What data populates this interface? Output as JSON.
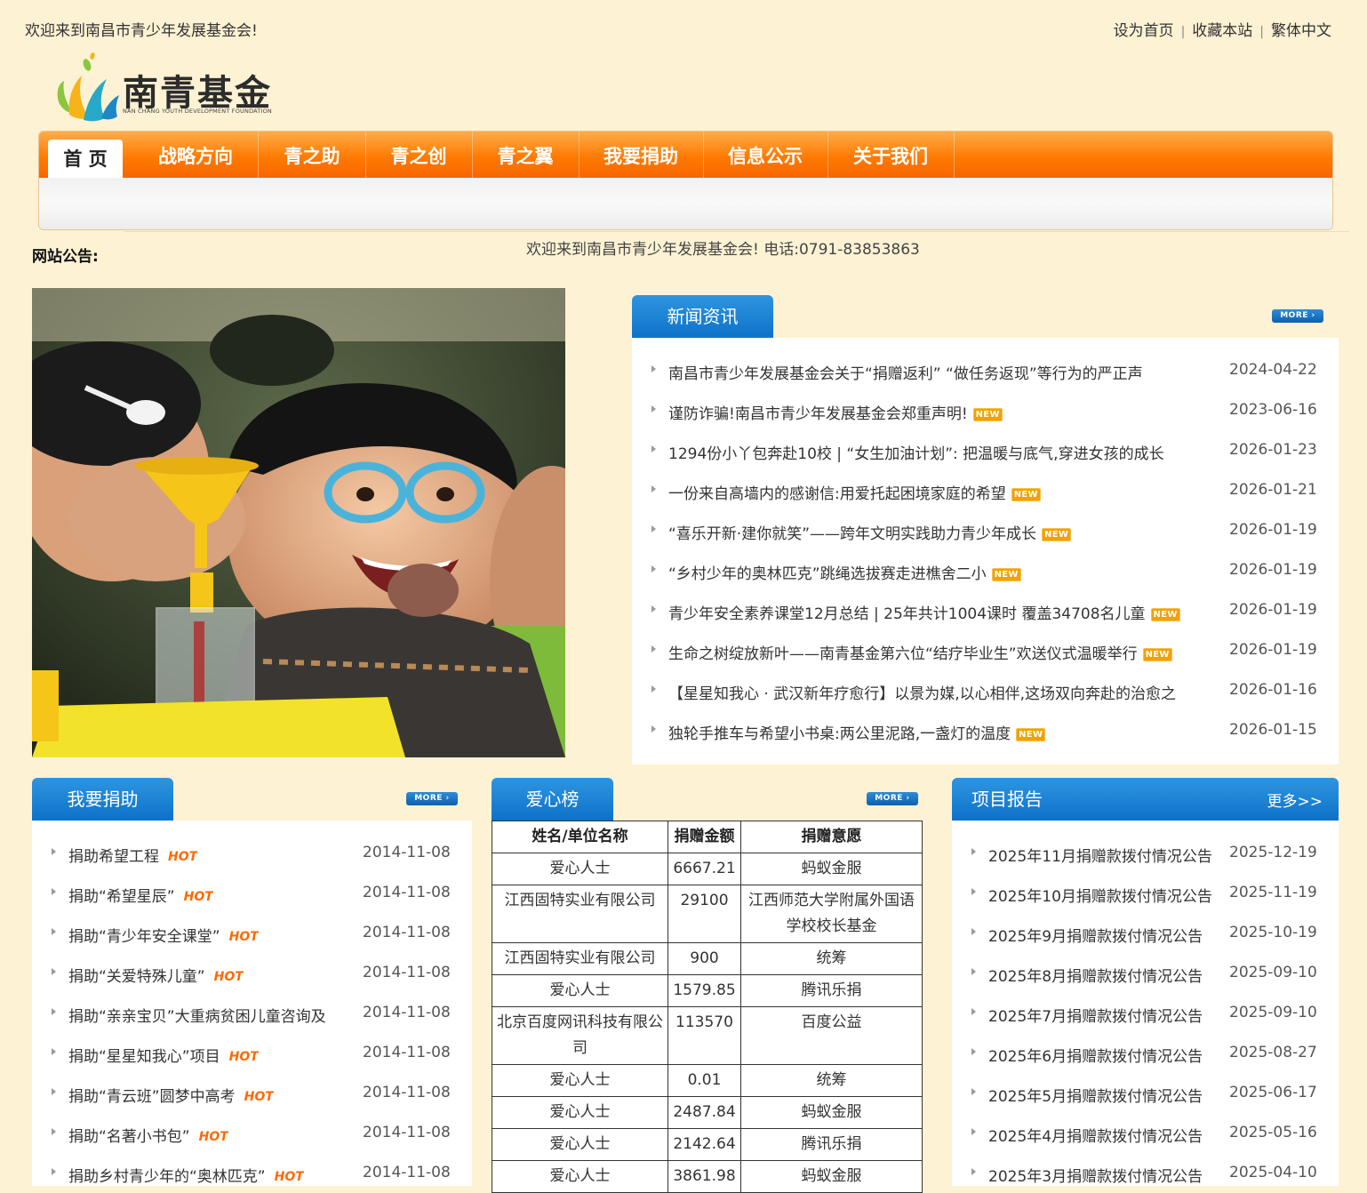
{
  "header": {
    "welcome": "欢迎来到南昌市青少年发展基金会!",
    "links": [
      "设为首页",
      "收藏本站",
      "繁体中文"
    ],
    "separator": "|"
  },
  "logo": {
    "name": "南青基金",
    "subtitle": "NAN CHANG YOUTH DEVELOPMENT FOUNDATION"
  },
  "nav": {
    "items": [
      "首 页",
      "战略方向",
      "青之助",
      "青之创",
      "青之翼",
      "我要捐助",
      "信息公示",
      "关于我们"
    ]
  },
  "notice": {
    "label": "网站公告:",
    "text": "欢迎来到南昌市青少年发展基金会! 电话:0791-83853863"
  },
  "badges": {
    "more": "MORE",
    "new": "NEW",
    "hot": "HOT"
  },
  "news": {
    "title": "新闻资讯",
    "items": [
      {
        "title": "南昌市青少年发展基金会关于“捐赠返利” “做任务返现”等行为的严正声",
        "date": "2024-04-22",
        "new": false
      },
      {
        "title": "谨防诈骗!南昌市青少年发展基金会郑重声明!",
        "date": "2023-06-16",
        "new": true
      },
      {
        "title": "1294份小丫包奔赴10校 | “女生加油计划”: 把温暖与底气,穿进女孩的成长",
        "date": "2026-01-23",
        "new": false
      },
      {
        "title": "一份来自高墙内的感谢信:用爱托起困境家庭的希望",
        "date": "2026-01-21",
        "new": true
      },
      {
        "title": "“喜乐开新·建你就笑”——跨年文明实践助力青少年成长",
        "date": "2026-01-19",
        "new": true
      },
      {
        "title": "“乡村少年的奥林匹克”跳绳选拔赛走进樵舍二小",
        "date": "2026-01-19",
        "new": true
      },
      {
        "title": "青少年安全素养课堂12月总结 | 25年共计1004课时 覆盖34708名儿童",
        "date": "2026-01-19",
        "new": true
      },
      {
        "title": "生命之树绽放新叶——南青基金第六位“结疗毕业生”欢送仪式温暖举行",
        "date": "2026-01-19",
        "new": true
      },
      {
        "title": "【星星知我心 · 武汉新年疗愈行】以景为媒,以心相伴,这场双向奔赴的治愈之",
        "date": "2026-01-16",
        "new": false
      },
      {
        "title": "独轮手推车与希望小书桌:两公里泥路,一盏灯的温度",
        "date": "2026-01-15",
        "new": true
      }
    ]
  },
  "donate": {
    "title": "我要捐助",
    "items": [
      {
        "title": "捐助希望工程",
        "date": "2014-11-08"
      },
      {
        "title": "捐助“希望星辰”",
        "date": "2014-11-08"
      },
      {
        "title": "捐助“青少年安全课堂”",
        "date": "2014-11-08"
      },
      {
        "title": "捐助“关爱特殊儿童”",
        "date": "2014-11-08"
      },
      {
        "title": "捐助“亲亲宝贝”大重病贫困儿童咨询及",
        "date": "2014-11-08"
      },
      {
        "title": "捐助“星星知我心”项目",
        "date": "2014-11-08"
      },
      {
        "title": "捐助“青云班”圆梦中高考",
        "date": "2014-11-08"
      },
      {
        "title": "捐助“名著小书包”",
        "date": "2014-11-08"
      },
      {
        "title": "捐助乡村青少年的“奥林匹克”",
        "date": "2014-11-08"
      }
    ]
  },
  "love": {
    "title": "爱心榜",
    "headers": [
      "姓名/单位名称",
      "捐赠金额",
      "捐赠意愿"
    ],
    "rows": [
      [
        "爱心人士",
        "6667.21",
        "蚂蚁金服"
      ],
      [
        "江西固特实业有限公司",
        "29100",
        "江西师范大学附属外国语学校校长基金"
      ],
      [
        "江西固特实业有限公司",
        "900",
        "统筹"
      ],
      [
        "爱心人士",
        "1579.85",
        "腾讯乐捐"
      ],
      [
        "北京百度网讯科技有限公司",
        "113570",
        "百度公益"
      ],
      [
        "爱心人士",
        "0.01",
        "统筹"
      ],
      [
        "爱心人士",
        "2487.84",
        "蚂蚁金服"
      ],
      [
        "爱心人士",
        "2142.64",
        "腾讯乐捐"
      ],
      [
        "爱心人士",
        "3861.98",
        "蚂蚁金服"
      ]
    ]
  },
  "report": {
    "title": "项目报告",
    "more": "更多>>",
    "items": [
      {
        "title": "2025年11月捐赠款拨付情况公告",
        "date": "2025-12-19"
      },
      {
        "title": "2025年10月捐赠款拨付情况公告",
        "date": "2025-11-19"
      },
      {
        "title": "2025年9月捐赠款拨付情况公告",
        "date": "2025-10-19"
      },
      {
        "title": "2025年8月捐赠款拨付情况公告",
        "date": "2025-09-10"
      },
      {
        "title": "2025年7月捐赠款拨付情况公告",
        "date": "2025-09-10"
      },
      {
        "title": "2025年6月捐赠款拨付情况公告",
        "date": "2025-08-27"
      },
      {
        "title": "2025年5月捐赠款拨付情况公告",
        "date": "2025-06-17"
      },
      {
        "title": "2025年4月捐赠款拨付情况公告",
        "date": "2025-05-16"
      },
      {
        "title": "2025年3月捐赠款拨付情况公告",
        "date": "2025-04-10"
      }
    ]
  }
}
